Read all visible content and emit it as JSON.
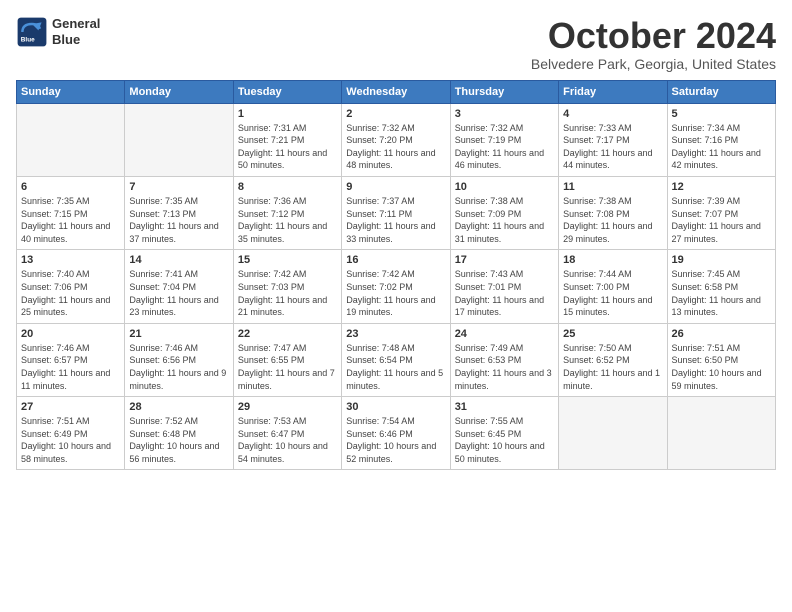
{
  "header": {
    "logo_line1": "General",
    "logo_line2": "Blue",
    "month": "October 2024",
    "location": "Belvedere Park, Georgia, United States"
  },
  "weekdays": [
    "Sunday",
    "Monday",
    "Tuesday",
    "Wednesday",
    "Thursday",
    "Friday",
    "Saturday"
  ],
  "weeks": [
    [
      {
        "day": "",
        "empty": true
      },
      {
        "day": "",
        "empty": true
      },
      {
        "day": "1",
        "sunrise": "Sunrise: 7:31 AM",
        "sunset": "Sunset: 7:21 PM",
        "daylight": "Daylight: 11 hours and 50 minutes."
      },
      {
        "day": "2",
        "sunrise": "Sunrise: 7:32 AM",
        "sunset": "Sunset: 7:20 PM",
        "daylight": "Daylight: 11 hours and 48 minutes."
      },
      {
        "day": "3",
        "sunrise": "Sunrise: 7:32 AM",
        "sunset": "Sunset: 7:19 PM",
        "daylight": "Daylight: 11 hours and 46 minutes."
      },
      {
        "day": "4",
        "sunrise": "Sunrise: 7:33 AM",
        "sunset": "Sunset: 7:17 PM",
        "daylight": "Daylight: 11 hours and 44 minutes."
      },
      {
        "day": "5",
        "sunrise": "Sunrise: 7:34 AM",
        "sunset": "Sunset: 7:16 PM",
        "daylight": "Daylight: 11 hours and 42 minutes."
      }
    ],
    [
      {
        "day": "6",
        "sunrise": "Sunrise: 7:35 AM",
        "sunset": "Sunset: 7:15 PM",
        "daylight": "Daylight: 11 hours and 40 minutes."
      },
      {
        "day": "7",
        "sunrise": "Sunrise: 7:35 AM",
        "sunset": "Sunset: 7:13 PM",
        "daylight": "Daylight: 11 hours and 37 minutes."
      },
      {
        "day": "8",
        "sunrise": "Sunrise: 7:36 AM",
        "sunset": "Sunset: 7:12 PM",
        "daylight": "Daylight: 11 hours and 35 minutes."
      },
      {
        "day": "9",
        "sunrise": "Sunrise: 7:37 AM",
        "sunset": "Sunset: 7:11 PM",
        "daylight": "Daylight: 11 hours and 33 minutes."
      },
      {
        "day": "10",
        "sunrise": "Sunrise: 7:38 AM",
        "sunset": "Sunset: 7:09 PM",
        "daylight": "Daylight: 11 hours and 31 minutes."
      },
      {
        "day": "11",
        "sunrise": "Sunrise: 7:38 AM",
        "sunset": "Sunset: 7:08 PM",
        "daylight": "Daylight: 11 hours and 29 minutes."
      },
      {
        "day": "12",
        "sunrise": "Sunrise: 7:39 AM",
        "sunset": "Sunset: 7:07 PM",
        "daylight": "Daylight: 11 hours and 27 minutes."
      }
    ],
    [
      {
        "day": "13",
        "sunrise": "Sunrise: 7:40 AM",
        "sunset": "Sunset: 7:06 PM",
        "daylight": "Daylight: 11 hours and 25 minutes."
      },
      {
        "day": "14",
        "sunrise": "Sunrise: 7:41 AM",
        "sunset": "Sunset: 7:04 PM",
        "daylight": "Daylight: 11 hours and 23 minutes."
      },
      {
        "day": "15",
        "sunrise": "Sunrise: 7:42 AM",
        "sunset": "Sunset: 7:03 PM",
        "daylight": "Daylight: 11 hours and 21 minutes."
      },
      {
        "day": "16",
        "sunrise": "Sunrise: 7:42 AM",
        "sunset": "Sunset: 7:02 PM",
        "daylight": "Daylight: 11 hours and 19 minutes."
      },
      {
        "day": "17",
        "sunrise": "Sunrise: 7:43 AM",
        "sunset": "Sunset: 7:01 PM",
        "daylight": "Daylight: 11 hours and 17 minutes."
      },
      {
        "day": "18",
        "sunrise": "Sunrise: 7:44 AM",
        "sunset": "Sunset: 7:00 PM",
        "daylight": "Daylight: 11 hours and 15 minutes."
      },
      {
        "day": "19",
        "sunrise": "Sunrise: 7:45 AM",
        "sunset": "Sunset: 6:58 PM",
        "daylight": "Daylight: 11 hours and 13 minutes."
      }
    ],
    [
      {
        "day": "20",
        "sunrise": "Sunrise: 7:46 AM",
        "sunset": "Sunset: 6:57 PM",
        "daylight": "Daylight: 11 hours and 11 minutes."
      },
      {
        "day": "21",
        "sunrise": "Sunrise: 7:46 AM",
        "sunset": "Sunset: 6:56 PM",
        "daylight": "Daylight: 11 hours and 9 minutes."
      },
      {
        "day": "22",
        "sunrise": "Sunrise: 7:47 AM",
        "sunset": "Sunset: 6:55 PM",
        "daylight": "Daylight: 11 hours and 7 minutes."
      },
      {
        "day": "23",
        "sunrise": "Sunrise: 7:48 AM",
        "sunset": "Sunset: 6:54 PM",
        "daylight": "Daylight: 11 hours and 5 minutes."
      },
      {
        "day": "24",
        "sunrise": "Sunrise: 7:49 AM",
        "sunset": "Sunset: 6:53 PM",
        "daylight": "Daylight: 11 hours and 3 minutes."
      },
      {
        "day": "25",
        "sunrise": "Sunrise: 7:50 AM",
        "sunset": "Sunset: 6:52 PM",
        "daylight": "Daylight: 11 hours and 1 minute."
      },
      {
        "day": "26",
        "sunrise": "Sunrise: 7:51 AM",
        "sunset": "Sunset: 6:50 PM",
        "daylight": "Daylight: 10 hours and 59 minutes."
      }
    ],
    [
      {
        "day": "27",
        "sunrise": "Sunrise: 7:51 AM",
        "sunset": "Sunset: 6:49 PM",
        "daylight": "Daylight: 10 hours and 58 minutes."
      },
      {
        "day": "28",
        "sunrise": "Sunrise: 7:52 AM",
        "sunset": "Sunset: 6:48 PM",
        "daylight": "Daylight: 10 hours and 56 minutes."
      },
      {
        "day": "29",
        "sunrise": "Sunrise: 7:53 AM",
        "sunset": "Sunset: 6:47 PM",
        "daylight": "Daylight: 10 hours and 54 minutes."
      },
      {
        "day": "30",
        "sunrise": "Sunrise: 7:54 AM",
        "sunset": "Sunset: 6:46 PM",
        "daylight": "Daylight: 10 hours and 52 minutes."
      },
      {
        "day": "31",
        "sunrise": "Sunrise: 7:55 AM",
        "sunset": "Sunset: 6:45 PM",
        "daylight": "Daylight: 10 hours and 50 minutes."
      },
      {
        "day": "",
        "empty": true
      },
      {
        "day": "",
        "empty": true
      }
    ]
  ]
}
